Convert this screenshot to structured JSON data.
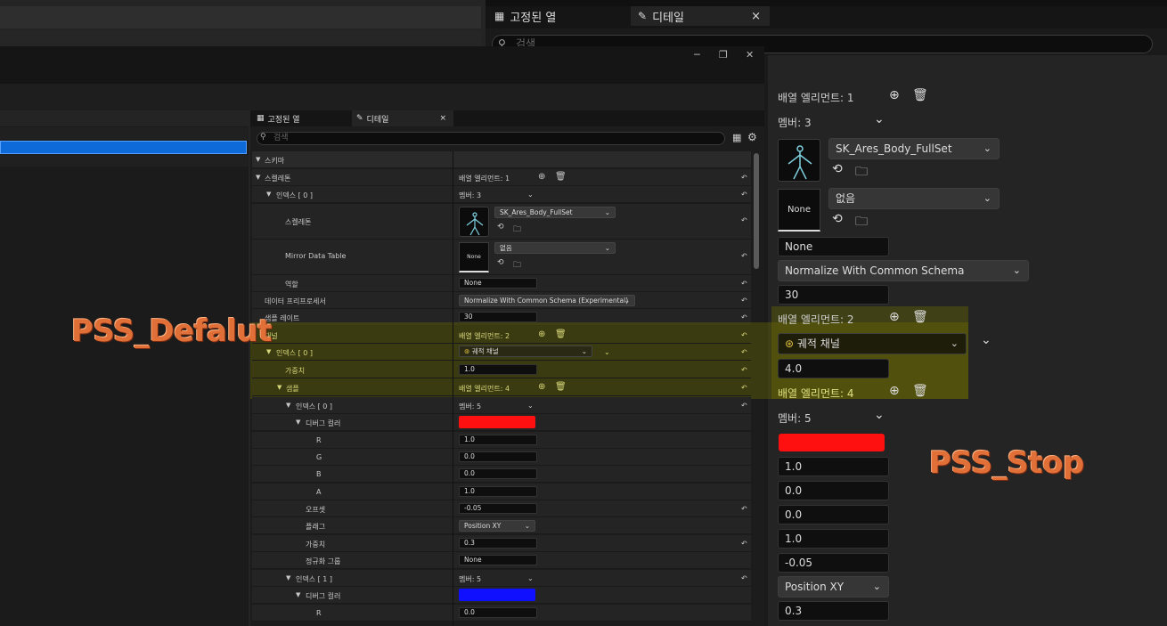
{
  "window": {
    "minimize": "─",
    "restore": "❐",
    "close": "✕"
  },
  "main_tabs": {
    "pinned_label": "고정된 열",
    "details_label": "디테일",
    "close": "×"
  },
  "main_search": {
    "placeholder": "검색"
  },
  "details_small": {
    "tab_pinned": "고정된 열",
    "tab_details": "디테일",
    "tab_close": "×",
    "search_placeholder": "검색",
    "rows": {
      "schema": "스키마",
      "skeleton_group": "스켈레톤",
      "array_elements_1": "배열 엘리먼트: 1",
      "index0": "인덱스 [ 0 ]",
      "members_3": "멤버: 3",
      "skeleton": "스켈레톤",
      "skeleton_asset": "SK_Ares_Body_FullSet",
      "mirror_table": "Mirror Data Table",
      "mirror_value": "없음",
      "thumb_none": "None",
      "role": "역할",
      "role_value": "None",
      "preprocessor": "데이터 프리프로세서",
      "preprocessor_value": "Normalize With Common Schema (Experimental)",
      "sample_rate": "샘플 레이트",
      "sample_rate_value": "30",
      "channel_group": "채널",
      "array_elements_2": "배열 엘리먼트: 2",
      "index0_b": "인덱스 [ 0 ]",
      "trajectory_channel": "궤적 채널",
      "weight": "가중치",
      "weight_value": "1.0",
      "samples": "샘플",
      "array_elements_4": "배열 엘리먼트: 4",
      "index0_c": "인덱스 [ 0 ]",
      "members_5": "멤버: 5",
      "debug_color": "디버그 컬러",
      "r": "R",
      "r_value": "1.0",
      "g": "G",
      "g_value": "0.0",
      "b": "B",
      "b_value": "0.0",
      "a": "A",
      "a_value": "1.0",
      "offset": "오프셋",
      "offset_value": "-0.05",
      "flags": "플래그",
      "flags_value": "Position XY",
      "weight2": "가중치",
      "weight2_value": "0.3",
      "norm_group": "정규화 그룹",
      "norm_group_value": "None",
      "index1": "인덱스 [ 1 ]",
      "members_5b": "멤버: 5",
      "debug_color2": "디버그 컬러",
      "r2": "R",
      "r2_value": "0.0"
    }
  },
  "details_large": {
    "array_elements_1": "배열 엘리먼트: 1",
    "members_3": "멤버: 3",
    "skeleton_asset": "SK_Ares_Body_FullSet",
    "mirror_value": "없음",
    "thumb_none": "None",
    "role_value": "None",
    "preprocessor_value": "Normalize With Common Schema (Experimental)",
    "sample_rate_value": "30",
    "array_elements_2": "배열 엘리먼트: 2",
    "trajectory_channel": "궤적 채널",
    "weight_value": "4.0",
    "array_elements_4": "배열 엘리먼트: 4",
    "members_5": "멤버: 5",
    "r_value": "1.0",
    "g_value": "0.0",
    "b_value": "0.0",
    "a_value": "1.0",
    "offset_value": "-0.05",
    "flags_value": "Position XY",
    "weight2_value": "0.3"
  },
  "overlays": {
    "left": "PSS_Defalut",
    "right": "PSS_Stop"
  },
  "colors": {
    "debug_red": "#ff1010",
    "debug_blue": "#1010ff",
    "highlight": "#6e6e00",
    "selection": "#0f6ad9",
    "overlay_text": "#e07038"
  }
}
